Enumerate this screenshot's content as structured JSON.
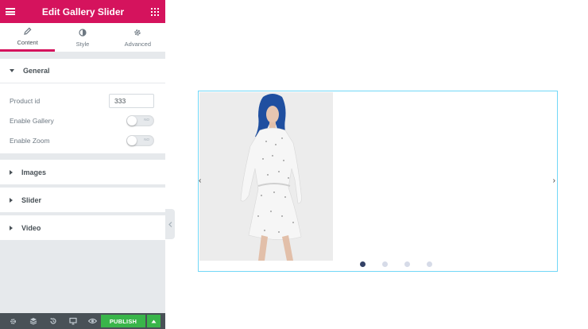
{
  "header": {
    "title": "Edit Gallery Slider"
  },
  "tabs": [
    {
      "label": "Content"
    },
    {
      "label": "Style"
    },
    {
      "label": "Advanced"
    }
  ],
  "sections": {
    "general": "General",
    "images": "Images",
    "slider": "Slider",
    "video": "Video"
  },
  "controls": {
    "product_id_label": "Product id",
    "product_id_value": "333",
    "enable_gallery_label": "Enable Gallery",
    "enable_gallery_state": "NO",
    "enable_zoom_label": "Enable Zoom",
    "enable_zoom_state": "NO"
  },
  "footer": {
    "publish_label": "PUBLISH"
  },
  "slider": {
    "dots": [
      {
        "active": true
      },
      {
        "active": false
      },
      {
        "active": false
      },
      {
        "active": false
      }
    ]
  },
  "colors": {
    "brand": "#d5135d",
    "publish": "#39b54a",
    "footer_bg": "#495157",
    "panel_bg": "#e6e9ec",
    "slider_border": "#71d7f7",
    "dot_active": "#334166",
    "dot_inactive": "#d6dbe8"
  },
  "icons": {
    "menu": "hamburger-icon",
    "apps": "grid-icon",
    "content": "pencil-icon",
    "style": "contrast-icon",
    "advanced": "gear-icon"
  }
}
